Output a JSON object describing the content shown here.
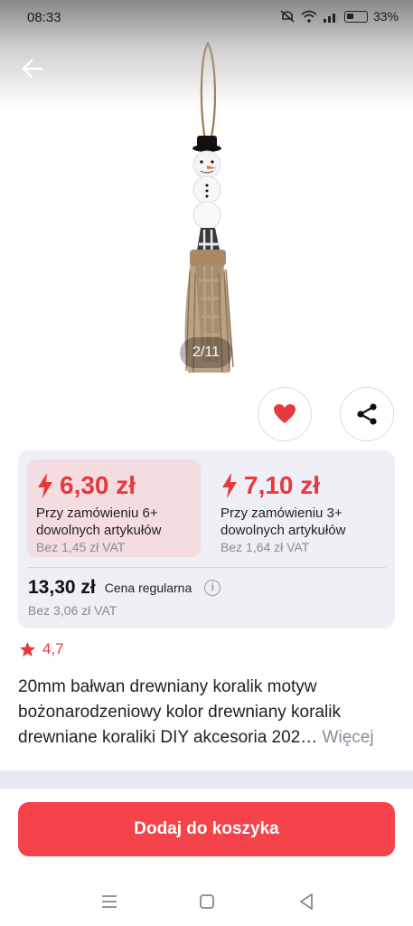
{
  "status_bar": {
    "time": "08:33",
    "battery": "33%"
  },
  "gallery": {
    "counter": "2/11"
  },
  "pricing": {
    "tiers": [
      {
        "price": "6,30 zł",
        "condition": "Przy zamówieniu 6+ dowolnych artykułów",
        "vat": "Bez 1,45 zł VAT"
      },
      {
        "price": "7,10 zł",
        "condition": "Przy zamówieniu 3+ dowolnych artykułów",
        "vat": "Bez 1,64 zł VAT"
      }
    ],
    "regular": {
      "price": "13,30 zł",
      "label": "Cena regularna",
      "vat": "Bez 3,06 zł VAT"
    }
  },
  "rating": {
    "value": "4,7"
  },
  "product": {
    "title": "20mm bałwan drewniany koralik motyw bożonarodzeniowy kolor drewniany koralik drewniane koraliki DIY akcesoria 202…",
    "more_label": "Więcej"
  },
  "cart": {
    "add_label": "Dodaj do koszyka"
  },
  "colors": {
    "accent": "#f4434b",
    "price_red": "#e6393e",
    "card_bg": "#eef0f6",
    "tier_highlight": "#f3dde1"
  }
}
